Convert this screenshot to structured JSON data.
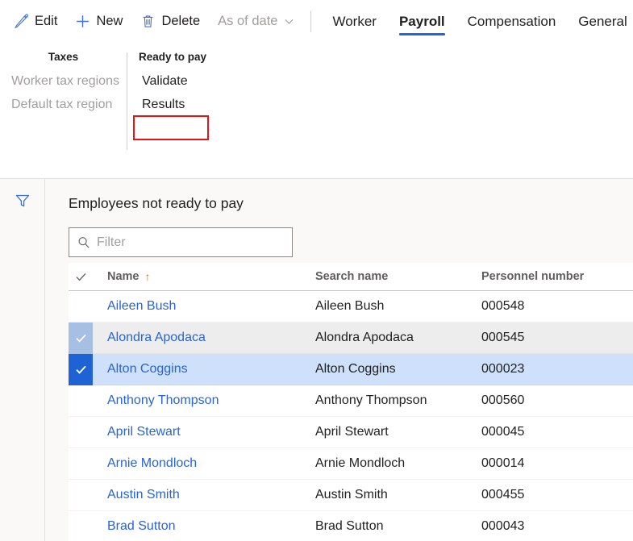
{
  "commandbar": {
    "buttons": [
      {
        "label": "Edit",
        "icon": "pencil-icon",
        "disabled": false
      },
      {
        "label": "New",
        "icon": "plus-icon",
        "disabled": false
      },
      {
        "label": "Delete",
        "icon": "trash-icon",
        "disabled": false
      },
      {
        "label": "As of date",
        "icon": "chevron-down-icon",
        "disabled": true
      }
    ],
    "tabs": [
      {
        "label": "Worker",
        "active": false
      },
      {
        "label": "Payroll",
        "active": true
      },
      {
        "label": "Compensation",
        "active": false
      },
      {
        "label": "General",
        "active": false
      }
    ]
  },
  "action_pane": {
    "groups": [
      {
        "title": "Taxes",
        "items": [
          {
            "label": "Worker tax regions",
            "disabled": true
          },
          {
            "label": "Default tax region",
            "disabled": true
          }
        ]
      },
      {
        "title": "Ready to pay",
        "items": [
          {
            "label": "Validate",
            "disabled": false,
            "highlighted": true
          },
          {
            "label": "Results",
            "disabled": false,
            "highlighted": false
          }
        ]
      }
    ]
  },
  "content": {
    "filter_rail_icon": "funnel-icon",
    "panel_title": "Employees not ready to pay",
    "filter": {
      "icon": "search-icon",
      "value": "",
      "placeholder": "Filter"
    },
    "grid": {
      "columns": [
        {
          "key": "name",
          "label": "Name",
          "sort": "ascending",
          "sort_glyph": "↑"
        },
        {
          "key": "search",
          "label": "Search name"
        },
        {
          "key": "pers",
          "label": "Personnel number"
        }
      ],
      "rows": [
        {
          "name": "Aileen Bush",
          "search": "Aileen Bush",
          "pers": "000548",
          "state": "normal"
        },
        {
          "name": "Alondra Apodaca",
          "search": "Alondra Apodaca",
          "pers": "000545",
          "state": "hovered"
        },
        {
          "name": "Alton Coggins",
          "search": "Alton Coggins",
          "pers": "000023",
          "state": "selected"
        },
        {
          "name": "Anthony Thompson",
          "search": "Anthony Thompson",
          "pers": "000560",
          "state": "normal"
        },
        {
          "name": "April Stewart",
          "search": "April Stewart",
          "pers": "000045",
          "state": "normal"
        },
        {
          "name": "Arnie Mondloch",
          "search": "Arnie Mondloch",
          "pers": "000014",
          "state": "normal"
        },
        {
          "name": "Austin Smith",
          "search": "Austin Smith",
          "pers": "000455",
          "state": "normal"
        },
        {
          "name": "Brad Sutton",
          "search": "Brad Sutton",
          "pers": "000043",
          "state": "normal"
        }
      ]
    }
  },
  "colors": {
    "accent_blue": "#2266dd",
    "link_blue": "#2764d8",
    "selection_blue": "#1f62d4",
    "selection_row": "#cfe0fa",
    "hover_check": "#a7bfe3",
    "highlight_red": "#ee1111",
    "panel_bg": "#faf9f8",
    "disabled_text": "#a19f9d"
  }
}
